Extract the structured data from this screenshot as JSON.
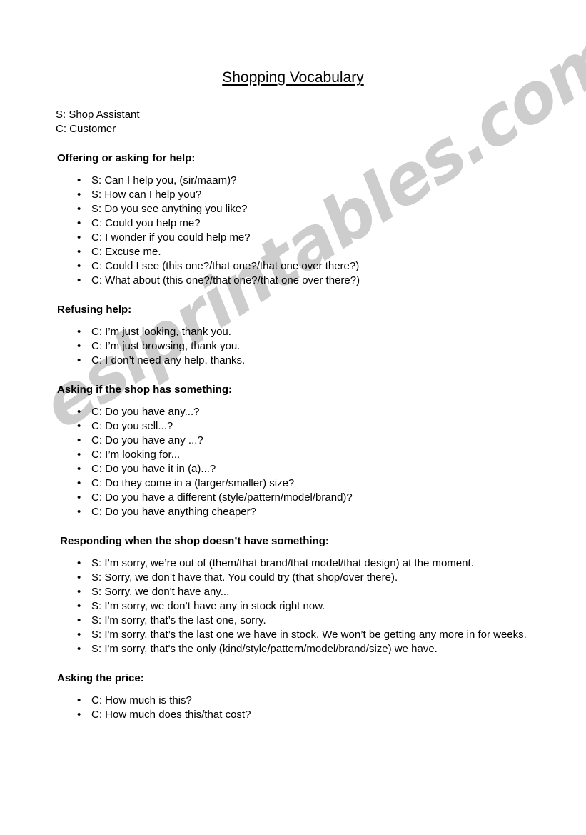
{
  "document": {
    "title": "Shopping Vocabulary",
    "watermark": "eslprintables.com",
    "watermark_color": "#cdcdcd",
    "text_color": "#000000",
    "background_color": "#ffffff"
  },
  "legend": {
    "line1": "S: Shop Assistant",
    "line2": "C: Customer"
  },
  "sections": [
    {
      "heading": "Offering or asking for help:",
      "items": [
        "S: Can I help you, (sir/maam)?",
        "S: How can I help you?",
        "S: Do you see anything you like?",
        "C: Could you help me?",
        "C: I wonder if you could help me?",
        "C: Excuse me.",
        "C: Could I see (this one?/that one?/that one over there?)",
        "C: What about (this one?/that one?/that one over there?)"
      ]
    },
    {
      "heading": "Refusing help:",
      "items": [
        "C: I’m just looking, thank you.",
        "C: I’m just browsing, thank you.",
        "C: I don’t need any help, thanks."
      ]
    },
    {
      "heading": "Asking if the shop has something:",
      "items": [
        "C: Do you have any...?",
        "C: Do you sell...?",
        "C: Do you have any ...?",
        "C: I’m looking for...",
        "C: Do you have it in (a)...?",
        "C: Do they come in a (larger/smaller) size?",
        "C: Do you have a different (style/pattern/model/brand)?",
        "C: Do you have anything cheaper?"
      ]
    },
    {
      "heading": " Responding when the shop doesn’t have something:",
      "items": [
        "S: I’m sorry, we’re out of (them/that brand/that model/that design) at the moment.",
        "S: Sorry, we don’t have that. You could try (that shop/over there).",
        "S: Sorry, we don't have any...",
        "S: I’m sorry, we don’t have any in stock right now.",
        "S: I'm sorry, that’s the last one, sorry.",
        "S: I'm sorry, that’s the last one we have in stock. We won’t be getting any more in for weeks.",
        "S: I'm sorry, that's the only (kind/style/pattern/model/brand/size) we have."
      ]
    },
    {
      "heading": "Asking the price:",
      "items": [
        "C: How much is this?",
        "C: How much does this/that cost?"
      ]
    }
  ]
}
